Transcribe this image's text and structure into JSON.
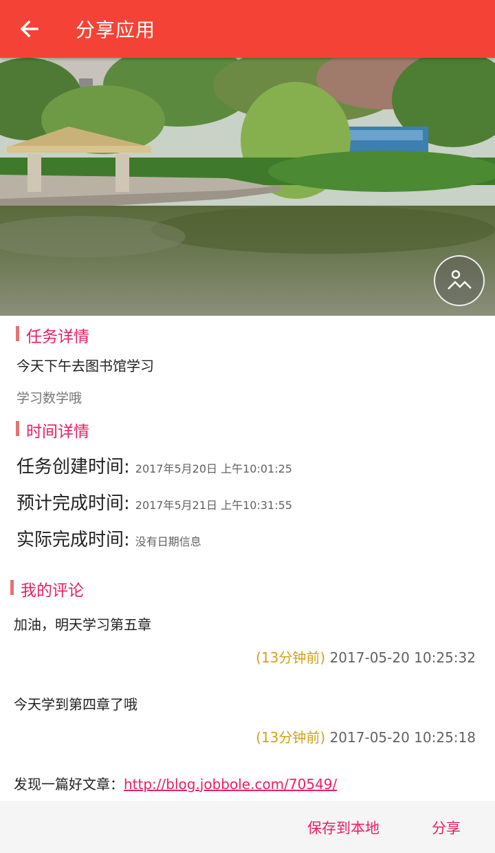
{
  "appbar": {
    "title": "分享应用",
    "back_icon": "arrow-back-icon"
  },
  "hero": {
    "photo_button_icon": "image-picker-icon"
  },
  "task_section": {
    "title": "任务详情",
    "task_title": "今天下午去图书馆学习",
    "task_desc": "学习数学哦"
  },
  "time_section": {
    "title": "时间详情",
    "rows": [
      {
        "label": "任务创建时间:",
        "value": "2017年5月20日 上午10:01:25"
      },
      {
        "label": "预计完成时间:",
        "value": "2017年5月21日 上午10:31:55"
      },
      {
        "label": "实际完成时间:",
        "value": "没有日期信息"
      }
    ]
  },
  "comments_section": {
    "title": "我的评论",
    "comments": [
      {
        "text": "加油，明天学习第五章",
        "ago": "(13分钟前)",
        "datetime": "2017-05-20 10:25:32"
      },
      {
        "text": "今天学到第四章了哦",
        "ago": "(13分钟前)",
        "datetime": "2017-05-20 10:25:18"
      }
    ],
    "link_comment": {
      "prefix": "发现一篇好文章：",
      "link": "http://blog.jobbole.com/70549/"
    }
  },
  "actions": {
    "save_label": "保存到本地",
    "share_label": "分享"
  },
  "colors": {
    "primary": "#f44336",
    "accent": "#e91e63",
    "ago": "#d4a017"
  }
}
